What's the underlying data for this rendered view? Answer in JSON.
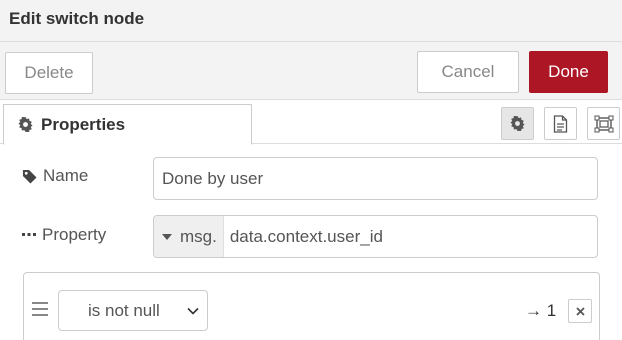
{
  "dialog": {
    "title": "Edit switch node"
  },
  "toolbar": {
    "delete_label": "Delete",
    "cancel_label": "Cancel",
    "done_label": "Done"
  },
  "tabs": {
    "properties_label": "Properties",
    "icons": [
      "gear-icon",
      "description-icon",
      "appearance-icon"
    ]
  },
  "form": {
    "name_label": "Name",
    "name_value": "Done by user",
    "property_label": "Property",
    "property_type": "msg.",
    "property_value": "data.context.user_id"
  },
  "rules": [
    {
      "operator": "is not null",
      "output": "→ 1"
    }
  ],
  "colors": {
    "accent": "#ad1625",
    "panel": "#f3f3f3",
    "border": "#cccccc"
  }
}
